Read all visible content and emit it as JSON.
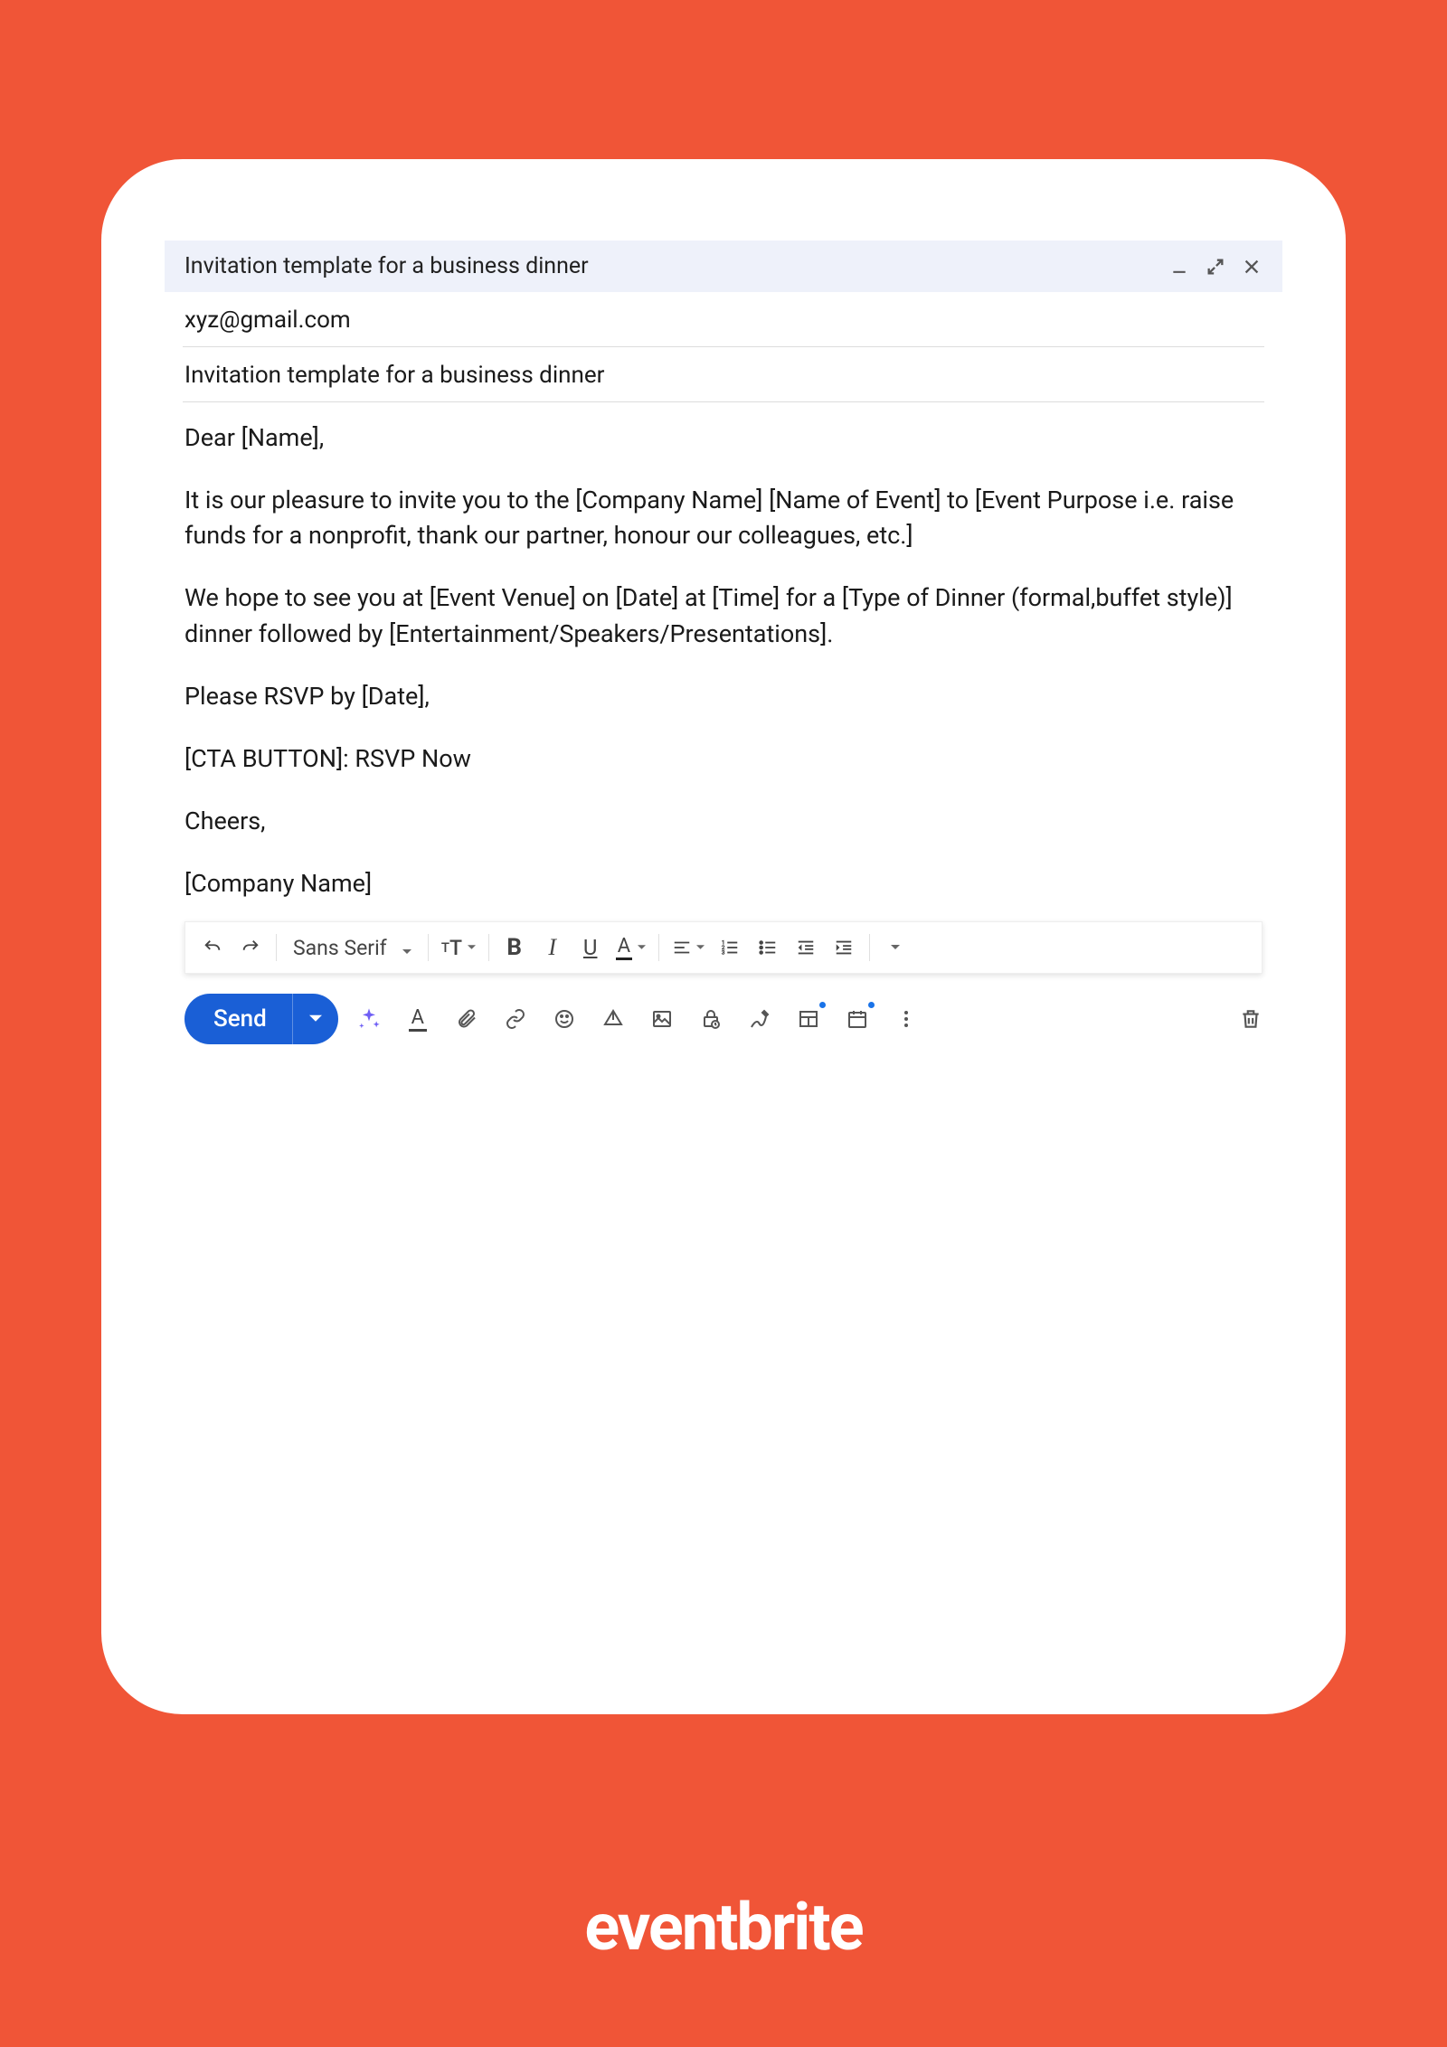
{
  "branding": {
    "logo_text": "eventbrite"
  },
  "window": {
    "title": "Invitation template for a business dinner"
  },
  "fields": {
    "to": "xyz@gmail.com",
    "subject": "Invitation template for a business dinner"
  },
  "body": {
    "p1": "Dear [Name],",
    "p2": "It is our pleasure to invite you to the [Company Name] [Name of Event] to [Event Purpose i.e. raise funds for a nonprofit, thank our partner, honour our colleagues, etc.]",
    "p3": "We hope to see you at [Event Venue] on [Date] at [Time] for a [Type of Dinner (formal,buffet style)] dinner followed by [Entertainment/Speakers/Presentations].",
    "p4": "Please RSVP by [Date],",
    "p5": "[CTA BUTTON]: RSVP Now",
    "p6": "Cheers,",
    "p7": "[Company Name]"
  },
  "format_toolbar": {
    "font_family": "Sans Serif"
  },
  "actions": {
    "send_label": "Send"
  }
}
